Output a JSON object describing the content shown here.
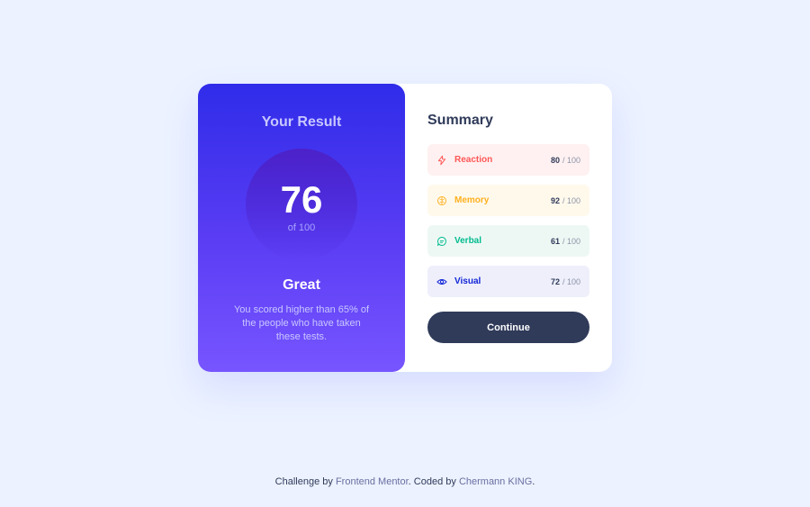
{
  "result": {
    "title": "Your Result",
    "score": "76",
    "score_of": "of 100",
    "rating": "Great",
    "description": "You scored higher than 65% of the people who have taken these tests."
  },
  "summary": {
    "title": "Summary",
    "items": [
      {
        "label": "Reaction",
        "score": "80",
        "max": "/ 100",
        "icon": "lightning-icon",
        "color": "#ff5757",
        "bg": "#fff1f1"
      },
      {
        "label": "Memory",
        "score": "92",
        "max": "/ 100",
        "icon": "brain-icon",
        "color": "#ffb01e",
        "bg": "#fff9ec"
      },
      {
        "label": "Verbal",
        "score": "61",
        "max": "/ 100",
        "icon": "chat-icon",
        "color": "#00bb8f",
        "bg": "#edf8f4"
      },
      {
        "label": "Visual",
        "score": "72",
        "max": "/ 100",
        "icon": "eye-icon",
        "color": "#1125d6",
        "bg": "#eeeffb"
      }
    ],
    "continue_label": "Continue"
  },
  "footer": {
    "prefix": "Challenge by ",
    "link1": "Frontend Mentor",
    "middle": ". Coded by ",
    "link2": "Chermann KING",
    "suffix": "."
  },
  "colors": {
    "background": "#ecf2ff",
    "gradient_start": "#2f2ce9",
    "gradient_end": "#7755ff",
    "dark_navy": "#303b5a"
  }
}
